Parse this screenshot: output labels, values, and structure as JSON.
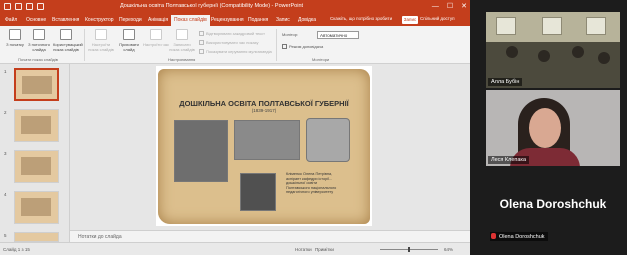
{
  "window": {
    "title": "Дошкільна освіта Полтавської губернії (Compatibility Mode) - PowerPoint",
    "controls": [
      "—",
      "☐",
      "✕"
    ]
  },
  "ribbon_tabs": [
    "Файл",
    "Основне",
    "Вставлення",
    "Конструктор",
    "Переходи",
    "Анімація",
    "Показ слайдів",
    "Рецензування",
    "Подання",
    "Запис",
    "Довідка"
  ],
  "active_tab_index": 6,
  "search_placeholder": "Скажіть, що потрібно зробити",
  "share_label": "Спільний доступ",
  "pill_label": "Запис",
  "ribbon": {
    "buttons": [
      {
        "label": "З початку",
        "dim": false
      },
      {
        "label": "З поточного слайда",
        "dim": false
      },
      {
        "label": "Користувацький показ слайдів",
        "dim": false
      },
      {
        "label": "Настроїти показ слайдів",
        "dim": true
      },
      {
        "label": "Приховати слайд",
        "dim": false
      },
      {
        "label": "Настроїти час",
        "dim": true
      },
      {
        "label": "Записати показ слайдів",
        "dim": true
      }
    ],
    "checks": [
      {
        "label": "Відтворювати закадровий текст",
        "on": false
      },
      {
        "label": "Використовувати час показу",
        "on": false
      },
      {
        "label": "Показувати керування мультимедіа",
        "on": false
      }
    ],
    "monitor_label": "Монітор:",
    "monitor_value": "Автоматично",
    "presenter_label": "Режим доповідача",
    "groups": [
      "Почати показ слайдів",
      "Настроювання",
      "Монітори"
    ]
  },
  "thumbnails": {
    "numbers": [
      "1",
      "2",
      "3",
      "4",
      "5"
    ],
    "active_index": 0
  },
  "slide": {
    "title": "ДОШКІЛЬНА ОСВІТА ПОЛТАВСЬКОЇ ГУБЕРНІЇ",
    "subtitle": "(1839-1917)",
    "caption": "Кліменко Олена Петрівна,\nаспірант кафедри історії...\nдошкільної освіти\nПолтавського національного\nпедагогічного університету"
  },
  "notes_placeholder": "Нотатки до слайда",
  "status": {
    "slide_counter": "Слайд 1 з 15",
    "notes_button": "Нотатки",
    "comments_button": "Примітки",
    "zoom": "64%"
  },
  "participants": [
    {
      "name": "Алла Бубін"
    },
    {
      "name": "Леся Клепака"
    },
    {
      "name": "Olena Doroshchuk"
    }
  ]
}
